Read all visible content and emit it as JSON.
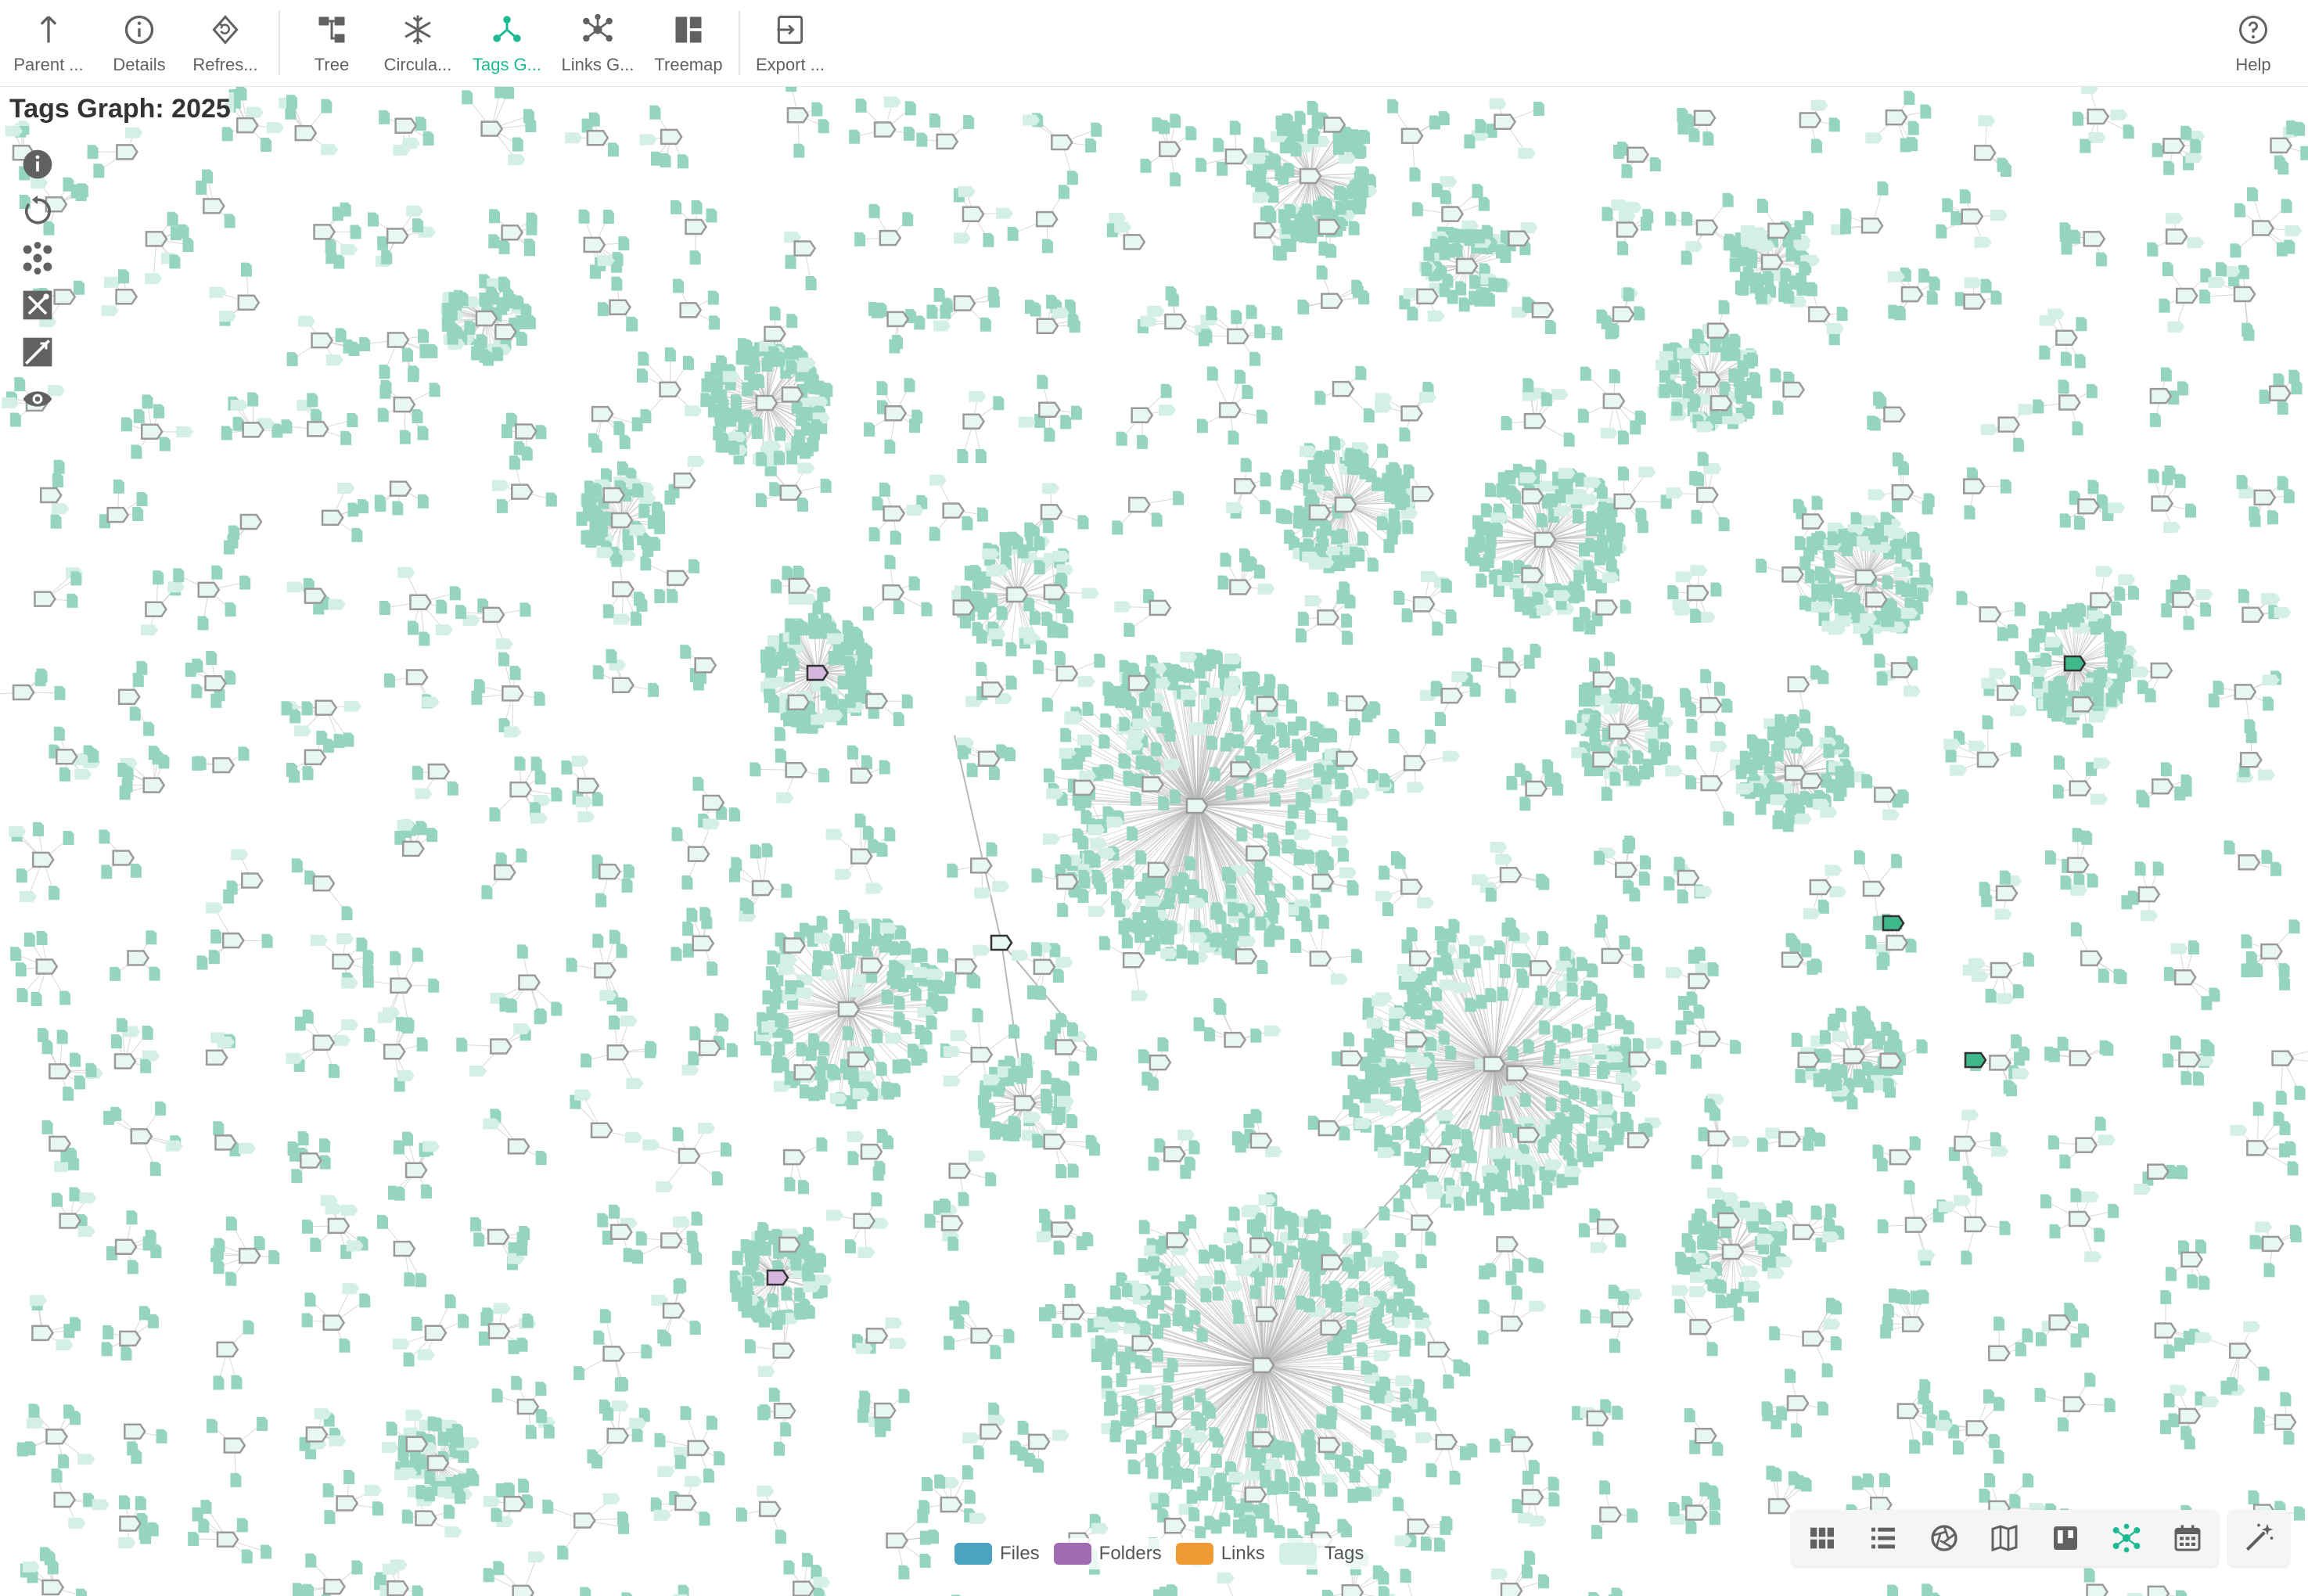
{
  "toolbar": {
    "buttons": [
      {
        "id": "parent",
        "label": "Parent ...",
        "icon": "arrow-up-icon",
        "active": false
      },
      {
        "id": "details",
        "label": "Details",
        "icon": "info-icon",
        "active": false
      },
      {
        "id": "refresh",
        "label": "Refres...",
        "icon": "refresh-icon",
        "active": false
      },
      {
        "id": "tree",
        "label": "Tree",
        "icon": "tree-icon",
        "active": false
      },
      {
        "id": "circular",
        "label": "Circula...",
        "icon": "snowflake-icon",
        "active": false
      },
      {
        "id": "tags-graph",
        "label": "Tags G...",
        "icon": "graph-icon",
        "active": true
      },
      {
        "id": "links-graph",
        "label": "Links G...",
        "icon": "network-icon",
        "active": false
      },
      {
        "id": "treemap",
        "label": "Treemap",
        "icon": "treemap-icon",
        "active": false
      },
      {
        "id": "export",
        "label": "Export ...",
        "icon": "export-icon",
        "active": false
      },
      {
        "id": "help",
        "label": "Help",
        "icon": "help-icon",
        "active": false
      }
    ]
  },
  "graph": {
    "title": "Tags Graph: 2025"
  },
  "side_tools": [
    "info-icon",
    "reset-icon",
    "cluster-icon",
    "hide-links-icon",
    "hide-labels-icon",
    "visibility-icon"
  ],
  "legend": {
    "items": [
      {
        "label": "Files",
        "color": "#4aa4c0"
      },
      {
        "label": "Folders",
        "color": "#a06bb0"
      },
      {
        "label": "Links",
        "color": "#f09a35"
      },
      {
        "label": "Tags",
        "color": "#d3efe6"
      }
    ]
  },
  "perspectives": [
    "grid-icon",
    "list-icon",
    "gallery-icon",
    "map-icon",
    "kanban-icon",
    "graph-icon",
    "calendar-icon"
  ],
  "colors": {
    "accent": "#1db992",
    "node_file": "#95d5bf",
    "node_tag": "#d3efe6",
    "edge": "#b8b8b8",
    "folder": "#a06bb0",
    "toolbar_icon": "#616161"
  }
}
